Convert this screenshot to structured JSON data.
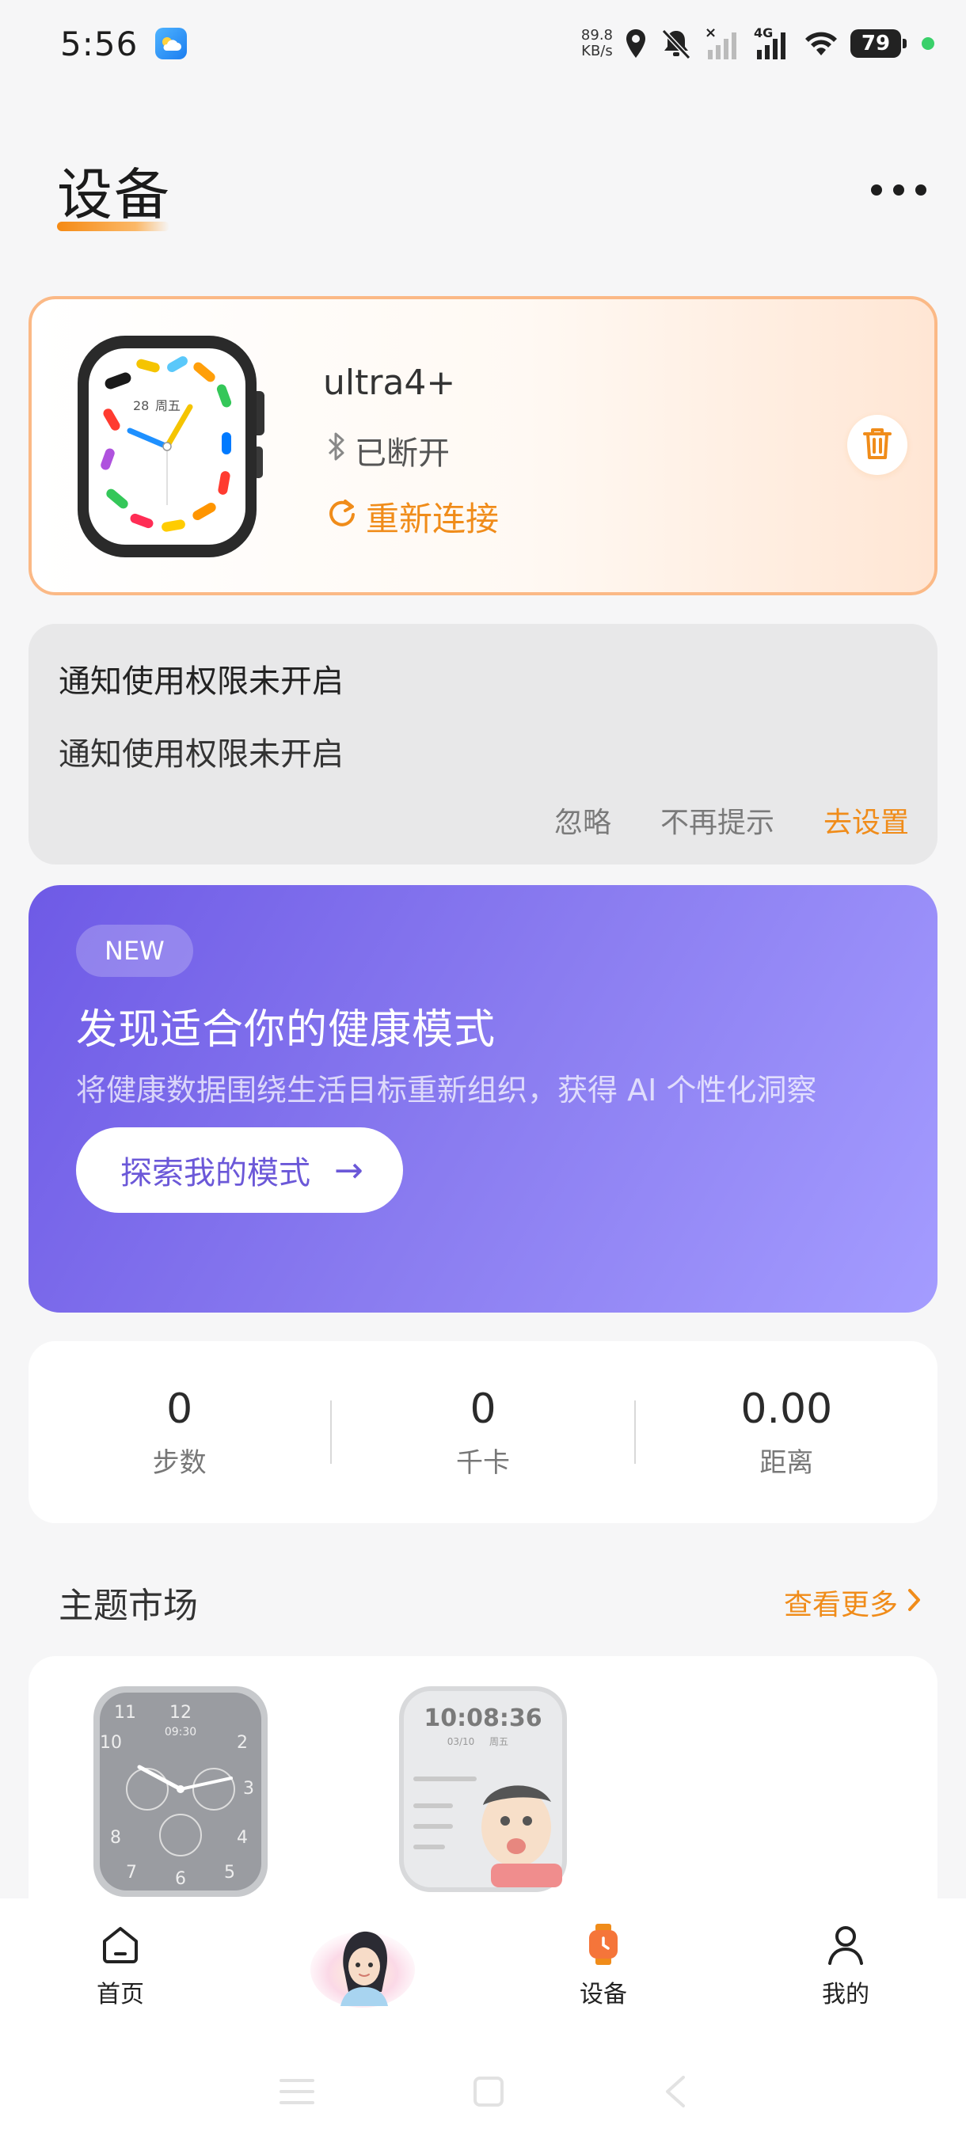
{
  "status_bar": {
    "time": "5:56",
    "net_speed_value": "89.8",
    "net_speed_unit": "KB/s",
    "network_type": "4G",
    "battery": "79"
  },
  "header": {
    "title": "设备"
  },
  "device": {
    "name": "ultra4+",
    "status": "已断开",
    "reconnect": "重新连接",
    "watch_date": "28",
    "watch_weekday": "周五"
  },
  "notice": {
    "title": "通知使用权限未开启",
    "body": "通知使用权限未开启",
    "ignore": "忽略",
    "dont_remind": "不再提示",
    "go_settings": "去设置"
  },
  "promo": {
    "badge": "NEW",
    "title": "发现适合你的健康模式",
    "subtitle": "将健康数据围绕生活目标重新组织，获得 AI 个性化洞察",
    "button": "探索我的模式",
    "button_arrow": "→"
  },
  "stats": [
    {
      "value": "0",
      "label": "步数"
    },
    {
      "value": "0",
      "label": "千卡"
    },
    {
      "value": "0.00",
      "label": "距离"
    }
  ],
  "theme_market": {
    "title": "主题市场",
    "see_more": "查看更多",
    "themes": [
      {
        "name": "analog-sport-face",
        "time": "09:30"
      },
      {
        "name": "cartoon-face",
        "time": "10:08:36",
        "date": "03/10",
        "weekday": "周五"
      }
    ]
  },
  "bottom_nav": {
    "home": "首页",
    "device": "设备",
    "mine": "我的"
  },
  "colors": {
    "accent": "#f08c1a",
    "promo_start": "#6e5ae6",
    "promo_end": "#a49cff"
  }
}
